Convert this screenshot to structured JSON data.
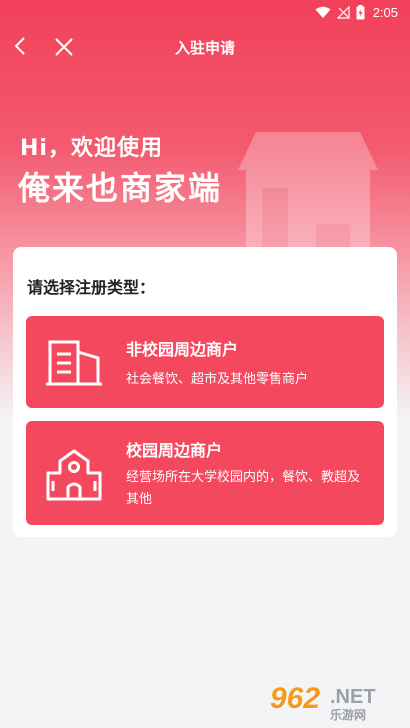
{
  "status_bar": {
    "time": "2:05",
    "battery_icon": "battery-charging-icon",
    "wifi_icon": "wifi-icon",
    "signal_icon": "signal-off-icon"
  },
  "nav": {
    "title": "入驻申请",
    "back_icon": "back-arrow-icon",
    "close_icon": "close-icon"
  },
  "hero": {
    "greeting": "Hi，欢迎使用",
    "brand": "俺来也商家端"
  },
  "selection": {
    "prompt": "请选择注册类型：",
    "options": [
      {
        "title": "非校园周边商户",
        "description": "社会餐饮、超市及其他零售商户",
        "icon": "building-icon"
      },
      {
        "title": "校园周边商户",
        "description": "经营场所在大学校园内的，餐饮、教超及其他",
        "icon": "school-icon"
      }
    ]
  },
  "watermark": {
    "number": "962",
    "net": ".NET",
    "sub": "乐游网"
  },
  "colors": {
    "accent": "#f4485f",
    "background": "#f4f4f6"
  }
}
